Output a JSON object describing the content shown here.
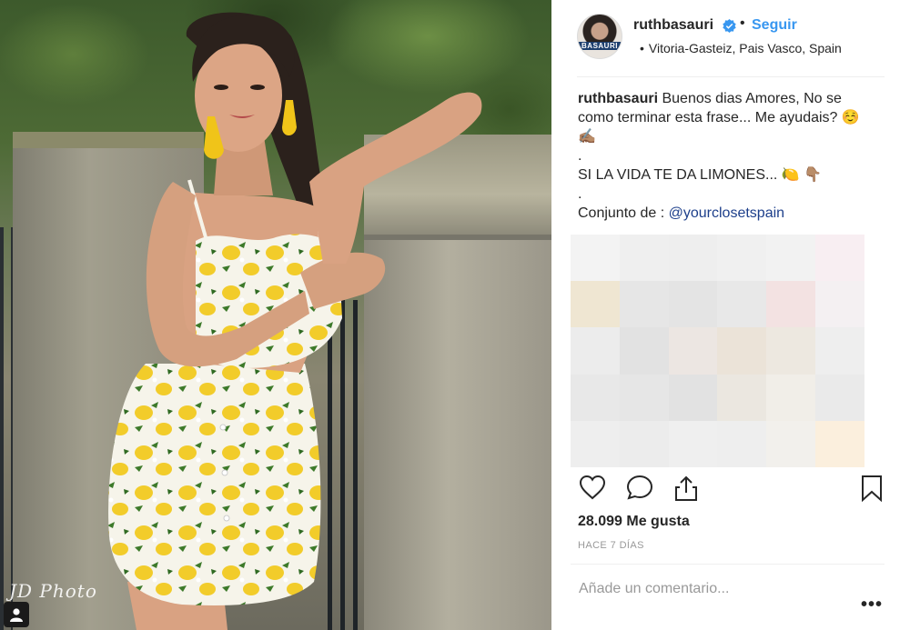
{
  "photo": {
    "watermark": "JD Photo",
    "user_tag_icon": "person-icon"
  },
  "post": {
    "username": "ruthbasauri",
    "avatar_text": "BASAURI",
    "verified_icon": "verified-badge-icon",
    "follow_label": "Seguir",
    "location": "Vitoria-Gasteiz, Pais Vasco, Spain",
    "caption": {
      "username": "ruthbasauri",
      "lines": [
        "Buenos dias Amores, No se",
        "como terminar esta frase... Me ayudais? ☺️",
        "✍🏽",
        ".",
        "SI LA VIDA TE DA LIMONES... 🍋 👇🏽",
        "."
      ],
      "credit_prefix": "Conjunto de : ",
      "mention": "@yourclosetspain"
    },
    "likes": "28.099 Me gusta",
    "timestamp": "HACE 7 DÍAS",
    "comment_placeholder": "Añade un comentario...",
    "more_label": "•••"
  },
  "colors": {
    "link_blue": "#3897f0",
    "mention_blue": "#1d3f8b",
    "text": "#262626",
    "muted": "#999999"
  }
}
